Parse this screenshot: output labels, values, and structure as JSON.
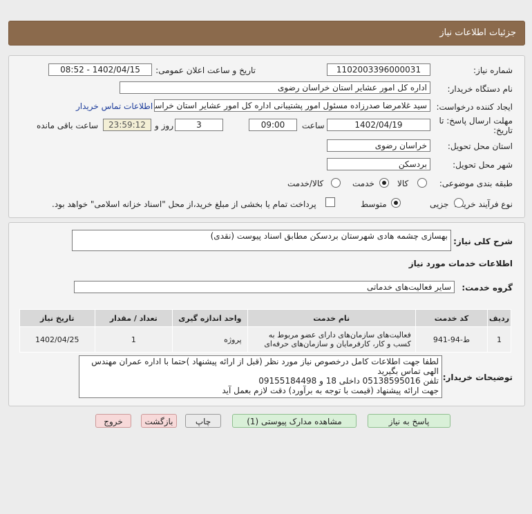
{
  "header": {
    "title": "جزئیات اطلاعات نیاز"
  },
  "form": {
    "need_number_label": "شماره نیاز:",
    "need_number": "1102003396000031",
    "announce_label": "تاریخ و ساعت اعلان عمومی:",
    "announce_value": "1402/04/15 - 08:52",
    "buyer_label": "نام دستگاه خریدار:",
    "buyer_value": "اداره کل امور عشایر استان خراسان رضوی",
    "creator_label": "ایجاد کننده درخواست:",
    "creator_value": "سید غلامرضا صدرزاده مسئول امور پشتیبانی اداره کل امور عشایر استان خراسان",
    "contact_link": "اطلاعات تماس خریدار",
    "deadline_label_1": "مهلت ارسال پاسخ: تا",
    "deadline_label_2": "تاریخ:",
    "deadline_date": "1402/04/19",
    "time_label": "ساعت",
    "deadline_time": "09:00",
    "days_value": "3",
    "days_label": "روز و",
    "remaining_time": "23:59:12",
    "remaining_label": "ساعت باقی مانده",
    "province_label": "استان محل تحویل:",
    "province_value": "خراسان رضوی",
    "city_label": "شهر محل تحویل:",
    "city_value": "بردسکن",
    "category_label": "طبقه بندی موضوعی:",
    "category_options": [
      "کالا",
      "خدمت",
      "کالا/خدمت"
    ],
    "process_label": "نوع فرآیند خرید :",
    "process_options": [
      "جزیی",
      "متوسط"
    ],
    "payment_note": "پرداخت تمام یا بخشی از مبلغ خرید،از محل \"اسناد خزانه اسلامی\" خواهد بود."
  },
  "details": {
    "summary_label": "شرح کلی نیاز:",
    "summary_value": "بهسازی چشمه هادی شهرستان بردسکن مطابق اسناد پیوست (نقدی)",
    "services_title": "اطلاعات خدمات مورد نیاز",
    "group_label": "گروه خدمت:",
    "group_value": "سایر فعالیت‌های خدماتی",
    "table": {
      "headers": [
        "ردیف",
        "کد خدمت",
        "نام خدمت",
        "واحد اندازه گیری",
        "تعداد / مقدار",
        "تاریخ نیاز"
      ],
      "rows": [
        [
          "1",
          "ط-94-941",
          "فعالیت‌های سازمان‌های دارای عضو مربوط به کسب و کار، کارفرمایان و سازمان‌های حرفه‌ای",
          "پروژه",
          "1",
          "1402/04/25"
        ]
      ]
    },
    "buyer_desc_label": "توضیحات خریدار:",
    "buyer_desc_lines": [
      "لطفا جهت اطلاعات کامل درخصوص نیاز مورد نظر (قبل از ارائه پیشنهاد )حتما با اداره عمران مهندس الهی تماس بگیرید",
      "تلفن 05138595016 داخلی 18 و 09155184498",
      "جهت ارائه پیشنهاد (قیمت با توجه به برآورد) دقت لازم  بعمل آید"
    ]
  },
  "buttons": {
    "reply": "پاسخ به نیاز",
    "view_docs": "مشاهده مدارک پیوستی (1)",
    "print": "چاپ",
    "back": "بازگشت",
    "exit": "خروج"
  }
}
